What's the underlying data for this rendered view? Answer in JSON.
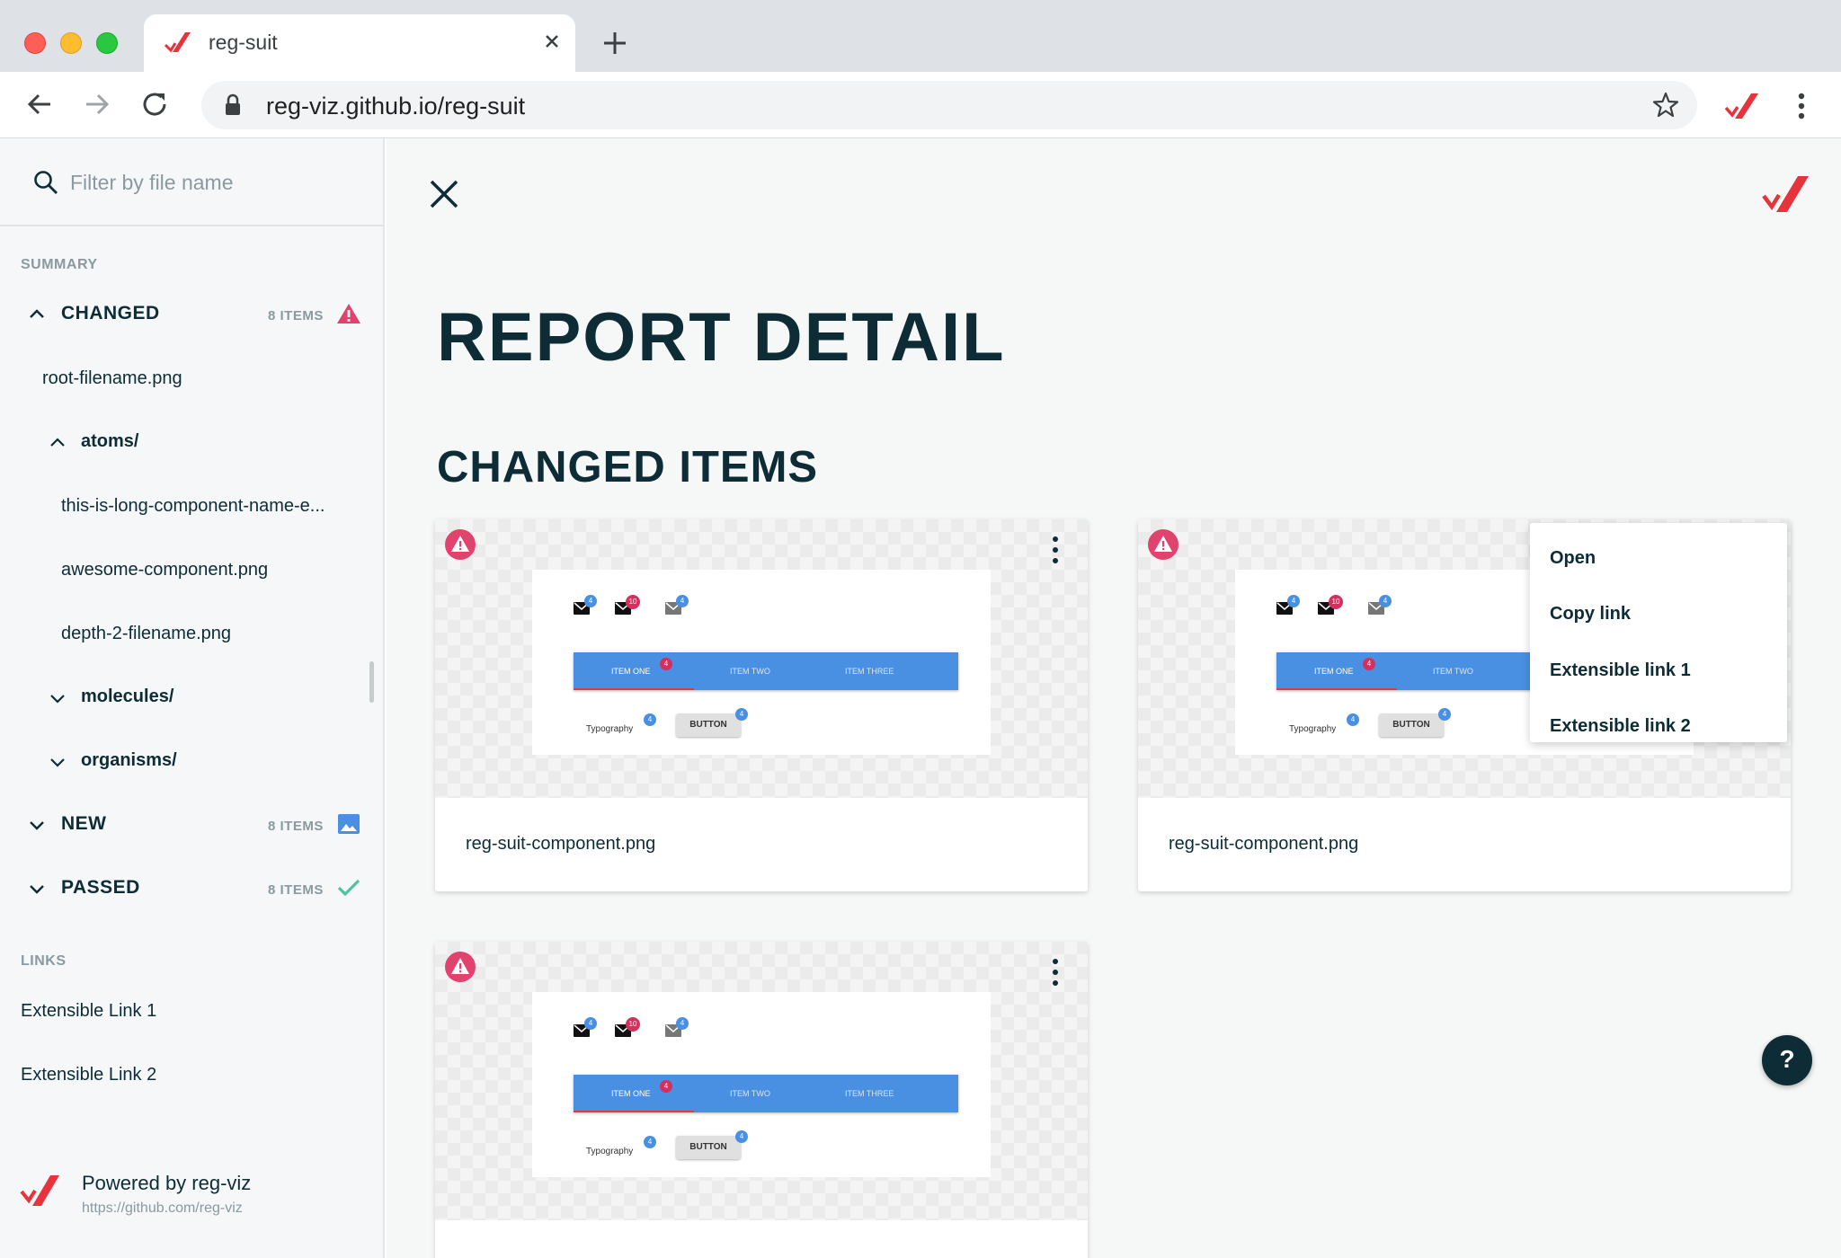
{
  "browser": {
    "tab_title": "reg-suit",
    "url": "reg-viz.github.io/reg-suit"
  },
  "sidebar": {
    "search_placeholder": "Filter by file name",
    "summary_label": "SUMMARY",
    "changed": {
      "label": "CHANGED",
      "count": "8 ITEMS",
      "root_file": "root-filename.png",
      "atoms_folder": "atoms/",
      "atoms_files": [
        "this-is-long-component-name-e...",
        "awesome-component.png",
        "depth-2-filename.png"
      ],
      "molecules_folder": "molecules/",
      "organisms_folder": "organisms/"
    },
    "new": {
      "label": "NEW",
      "count": "8 ITEMS"
    },
    "passed": {
      "label": "PASSED",
      "count": "8 ITEMS"
    },
    "links_label": "LINKS",
    "links": [
      "Extensible Link 1",
      "Extensible Link 2"
    ],
    "footer": {
      "title": "Powered by reg-viz",
      "url": "https://github.com/reg-viz"
    }
  },
  "main": {
    "page_title": "REPORT DETAIL",
    "section_title": "CHANGED ITEMS",
    "cards": [
      {
        "filename": "reg-suit-component.png"
      },
      {
        "filename": "reg-suit-component.png"
      },
      {
        "filename": ""
      }
    ],
    "preview": {
      "badges": [
        "4",
        "10",
        "4"
      ],
      "tabs": [
        "ITEM ONE",
        "ITEM TWO",
        "ITEM THREE"
      ],
      "tab_badge": "4",
      "typography": "Typography",
      "typography_badge": "4",
      "button": "BUTTON",
      "button_badge": "4"
    },
    "context_menu": [
      "Open",
      "Copy link",
      "Extensible link 1",
      "Extensible link 2"
    ],
    "help_label": "?"
  },
  "colors": {
    "accent": "#e8323c",
    "dark": "#0d2c36",
    "warning": "#e0436d",
    "success": "#4fc3a1",
    "info": "#4a90e2"
  }
}
